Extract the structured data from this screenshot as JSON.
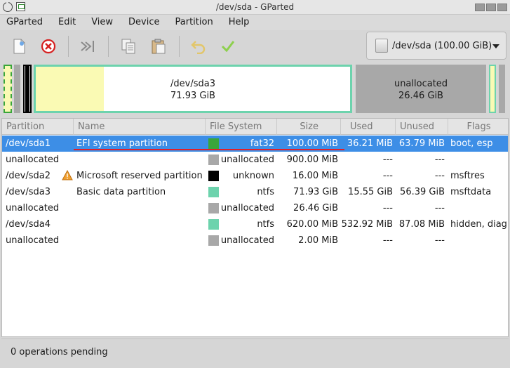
{
  "window": {
    "title": "/dev/sda - GParted"
  },
  "menu": [
    "GParted",
    "Edit",
    "View",
    "Device",
    "Partition",
    "Help"
  ],
  "toolbar": {
    "buttons": [
      "new-partition",
      "delete-partition",
      "resize-move",
      "copy",
      "paste",
      "undo",
      "apply"
    ],
    "device": "/dev/sda (100.00 GiB)"
  },
  "graphic": {
    "sda3": {
      "name": "/dev/sda3",
      "size": "71.93 GiB",
      "used_fraction": 0.216
    },
    "unallocated": {
      "name": "unallocated",
      "size": "26.46 GiB"
    }
  },
  "table": {
    "columns": [
      "Partition",
      "Name",
      "File System",
      "Size",
      "Used",
      "Unused",
      "Flags"
    ],
    "rows": [
      {
        "partition": "/dev/sda1",
        "name": "EFI system partition",
        "fs": "fat32",
        "fs_color": "#3aa63a",
        "size": "100.00 MiB",
        "used": "36.21 MiB",
        "unused": "63.79 MiB",
        "flags": "boot, esp",
        "warning": false
      },
      {
        "partition": "unallocated",
        "name": "",
        "fs": "unallocated",
        "fs_color": "#a8a8a8",
        "size": "900.00 MiB",
        "used": "---",
        "unused": "---",
        "flags": "",
        "warning": false
      },
      {
        "partition": "/dev/sda2",
        "name": "Microsoft reserved partition",
        "fs": "unknown",
        "fs_color": "#000000",
        "size": "16.00 MiB",
        "used": "---",
        "unused": "---",
        "flags": "msftres",
        "warning": true
      },
      {
        "partition": "/dev/sda3",
        "name": "Basic data partition",
        "fs": "ntfs",
        "fs_color": "#6dd3ad",
        "size": "71.93 GiB",
        "used": "15.55 GiB",
        "unused": "56.39 GiB",
        "flags": "msftdata",
        "warning": false
      },
      {
        "partition": "unallocated",
        "name": "",
        "fs": "unallocated",
        "fs_color": "#a8a8a8",
        "size": "26.46 GiB",
        "used": "---",
        "unused": "---",
        "flags": "",
        "warning": false
      },
      {
        "partition": "/dev/sda4",
        "name": "",
        "fs": "ntfs",
        "fs_color": "#6dd3ad",
        "size": "620.00 MiB",
        "used": "532.92 MiB",
        "unused": "87.08 MiB",
        "flags": "hidden, diag",
        "warning": false
      },
      {
        "partition": "unallocated",
        "name": "",
        "fs": "unallocated",
        "fs_color": "#a8a8a8",
        "size": "2.00 MiB",
        "used": "---",
        "unused": "---",
        "flags": "",
        "warning": false
      }
    ],
    "selected_row": 0
  },
  "status": {
    "text": "0 operations pending"
  },
  "colors": {
    "selection": "#3d8ee6",
    "ntfs": "#6dd3ad",
    "fat32": "#3aa63a",
    "unallocated": "#a8a8a8",
    "used_fill": "#fafab4"
  }
}
